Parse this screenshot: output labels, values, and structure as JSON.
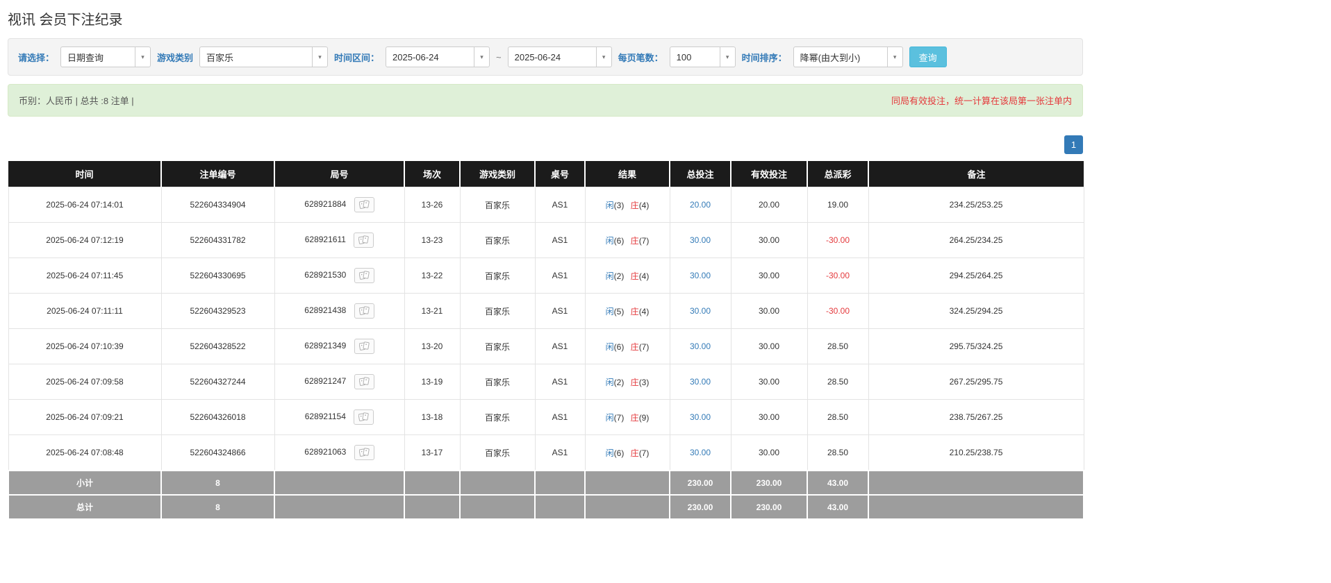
{
  "colors": {
    "accent": "#337ab7",
    "red": "#e4393c",
    "header-bg": "#1b1b1b",
    "footer-bg": "#9d9d9d",
    "summary-bg": "#dff0d8",
    "search-btn-bg": "#5bc0de"
  },
  "page": {
    "title": "视讯 会员下注纪录"
  },
  "filters": {
    "mode_label": "请选择：",
    "mode_value": "日期查询",
    "game_type_label": "游戏类别",
    "game_type_value": "百家乐",
    "time_range_label": "时间区间：",
    "time_from": "2025-06-24",
    "range_separator": "~",
    "time_to": "2025-06-24",
    "per_page_label": "每页笔数：",
    "per_page_value": "100",
    "sort_label": "时间排序：",
    "sort_value": "降幂(由大到小)",
    "search_button": "查询"
  },
  "summary": {
    "left": "币别：人民币 | 总共 :8 注单 |",
    "right": "同局有效投注，统一计算在该局第一张注单内"
  },
  "pagination": {
    "pages": [
      "1"
    ]
  },
  "table": {
    "headers": [
      "时间",
      "注单编号",
      "局号",
      "场次",
      "游戏类别",
      "桌号",
      "结果",
      "总投注",
      "有效投注",
      "总派彩",
      "备注"
    ],
    "rows": [
      {
        "time": "2025-06-24 07:14:01",
        "bet_id": "522604334904",
        "round_id": "628921884",
        "session": "13-26",
        "game": "百家乐",
        "table_no": "AS1",
        "player": "闲",
        "player_score": "(3)",
        "banker": "庄",
        "banker_score": "(4)",
        "total_bet": "20.00",
        "valid_bet": "20.00",
        "payout": "19.00",
        "note": "234.25/253.25"
      },
      {
        "time": "2025-06-24 07:12:19",
        "bet_id": "522604331782",
        "round_id": "628921611",
        "session": "13-23",
        "game": "百家乐",
        "table_no": "AS1",
        "player": "闲",
        "player_score": "(6)",
        "banker": "庄",
        "banker_score": "(7)",
        "total_bet": "30.00",
        "valid_bet": "30.00",
        "payout": "-30.00",
        "note": "264.25/234.25"
      },
      {
        "time": "2025-06-24 07:11:45",
        "bet_id": "522604330695",
        "round_id": "628921530",
        "session": "13-22",
        "game": "百家乐",
        "table_no": "AS1",
        "player": "闲",
        "player_score": "(2)",
        "banker": "庄",
        "banker_score": "(4)",
        "total_bet": "30.00",
        "valid_bet": "30.00",
        "payout": "-30.00",
        "note": "294.25/264.25"
      },
      {
        "time": "2025-06-24 07:11:11",
        "bet_id": "522604329523",
        "round_id": "628921438",
        "session": "13-21",
        "game": "百家乐",
        "table_no": "AS1",
        "player": "闲",
        "player_score": "(5)",
        "banker": "庄",
        "banker_score": "(4)",
        "total_bet": "30.00",
        "valid_bet": "30.00",
        "payout": "-30.00",
        "note": "324.25/294.25"
      },
      {
        "time": "2025-06-24 07:10:39",
        "bet_id": "522604328522",
        "round_id": "628921349",
        "session": "13-20",
        "game": "百家乐",
        "table_no": "AS1",
        "player": "闲",
        "player_score": "(6)",
        "banker": "庄",
        "banker_score": "(7)",
        "total_bet": "30.00",
        "valid_bet": "30.00",
        "payout": "28.50",
        "note": "295.75/324.25"
      },
      {
        "time": "2025-06-24 07:09:58",
        "bet_id": "522604327244",
        "round_id": "628921247",
        "session": "13-19",
        "game": "百家乐",
        "table_no": "AS1",
        "player": "闲",
        "player_score": "(2)",
        "banker": "庄",
        "banker_score": "(3)",
        "total_bet": "30.00",
        "valid_bet": "30.00",
        "payout": "28.50",
        "note": "267.25/295.75"
      },
      {
        "time": "2025-06-24 07:09:21",
        "bet_id": "522604326018",
        "round_id": "628921154",
        "session": "13-18",
        "game": "百家乐",
        "table_no": "AS1",
        "player": "闲",
        "player_score": "(7)",
        "banker": "庄",
        "banker_score": "(9)",
        "total_bet": "30.00",
        "valid_bet": "30.00",
        "payout": "28.50",
        "note": "238.75/267.25"
      },
      {
        "time": "2025-06-24 07:08:48",
        "bet_id": "522604324866",
        "round_id": "628921063",
        "session": "13-17",
        "game": "百家乐",
        "table_no": "AS1",
        "player": "闲",
        "player_score": "(6)",
        "banker": "庄",
        "banker_score": "(7)",
        "total_bet": "30.00",
        "valid_bet": "30.00",
        "payout": "28.50",
        "note": "210.25/238.75"
      }
    ],
    "footer_rows": [
      {
        "name": "subtotal",
        "cells": [
          "小计",
          "8",
          "",
          "",
          "",
          "",
          "",
          "230.00",
          "230.00",
          "43.00",
          ""
        ]
      },
      {
        "name": "total",
        "cells": [
          "总计",
          "8",
          "",
          "",
          "",
          "",
          "",
          "230.00",
          "230.00",
          "43.00",
          ""
        ]
      }
    ]
  }
}
